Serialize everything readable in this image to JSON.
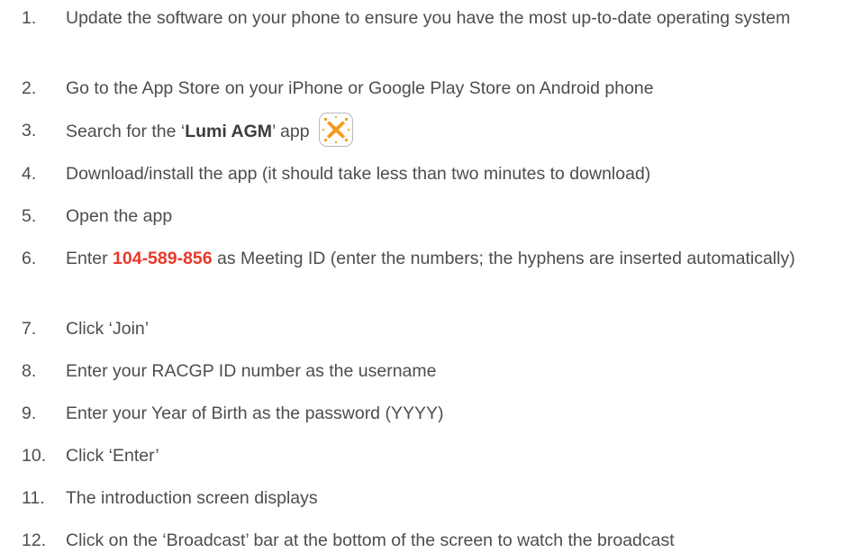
{
  "steps": [
    {
      "number": "1.",
      "text": "Update the software on your phone to ensure you have the most up-to-date operating system"
    },
    {
      "number": "2.",
      "text": "Go to the App Store on your iPhone or Google Play Store on Android phone"
    },
    {
      "number": "3.",
      "pre": "Search for the ‘",
      "app_name": "Lumi AGM",
      "post": "’ app",
      "icon": "lumi-app-icon"
    },
    {
      "number": "4.",
      "text": "Download/install the app (it should take less than two minutes to download)"
    },
    {
      "number": "5.",
      "text": "Open the app"
    },
    {
      "number": "6.",
      "pre": "Enter ",
      "meeting_id": "104-589-856",
      "post": " as Meeting ID (enter the numbers; the hyphens are inserted automatically)"
    },
    {
      "number": "7.",
      "text": "Click ‘Join’"
    },
    {
      "number": "8.",
      "text": "Enter your RACGP ID number as the username"
    },
    {
      "number": "9.",
      "text": "Enter your Year of Birth as the password (YYYY)"
    },
    {
      "number": "10.",
      "text": "Click ‘Enter’"
    },
    {
      "number": "11.",
      "text": "The introduction screen displays"
    },
    {
      "number": "12.",
      "text": "Click on the ‘Broadcast’ bar at the bottom of the screen to watch the broadcast"
    }
  ],
  "colors": {
    "text": "#4d4d4f",
    "accent": "#e8392b",
    "icon_orange": "#f39a1e"
  }
}
